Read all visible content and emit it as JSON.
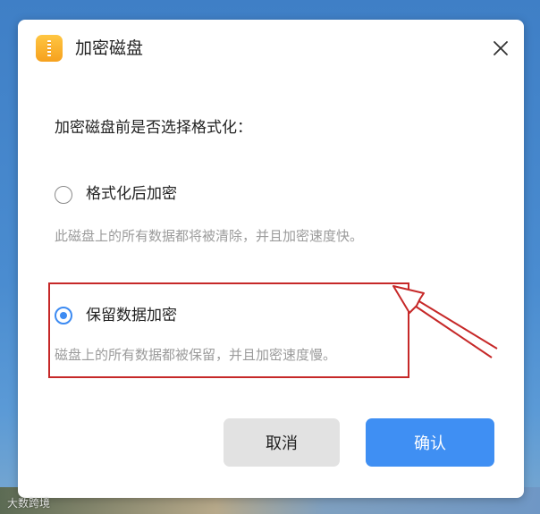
{
  "dialog": {
    "title": "加密磁盘",
    "question": "加密磁盘前是否选择格式化：",
    "options": [
      {
        "label": "格式化后加密",
        "description": "此磁盘上的所有数据都将被清除，并且加密速度快。",
        "selected": false
      },
      {
        "label": "保留数据加密",
        "description": "磁盘上的所有数据都被保留，并且加密速度慢。",
        "selected": true
      }
    ],
    "buttons": {
      "cancel": "取消",
      "confirm": "确认"
    }
  },
  "annotation": {
    "highlight_color": "#c62828"
  },
  "colors": {
    "accent": "#3f8ff3",
    "app_icon": "#f6a11e"
  },
  "watermark": "大数跨境"
}
